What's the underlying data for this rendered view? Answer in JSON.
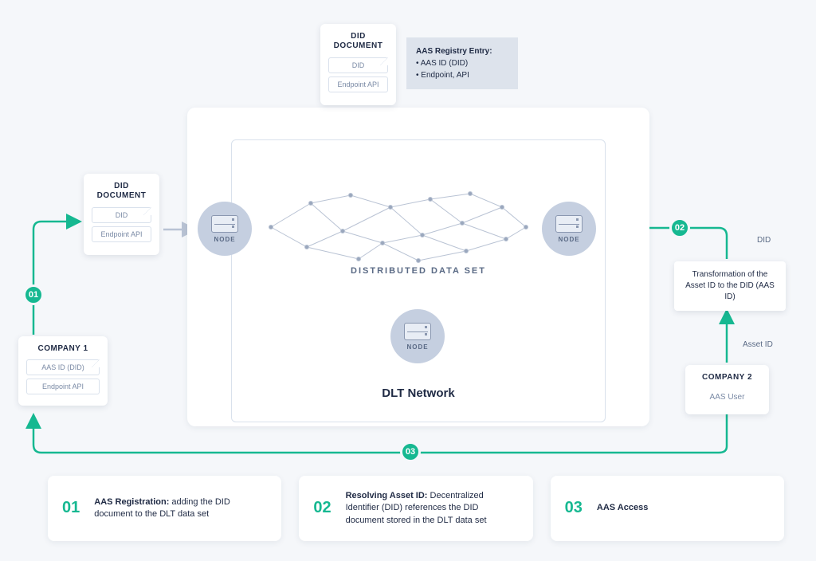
{
  "didDocument": {
    "title": "DID\nDOCUMENT",
    "chip1": "DID",
    "chip2": "Endpoint API"
  },
  "registry": {
    "heading": "AAS Registry Entry:",
    "line1": "• AAS ID (DID)",
    "line2": "• Endpoint, API"
  },
  "dlt": {
    "distributed": "DISTRIBUTED DATA SET",
    "title": "DLT Network",
    "nodeLabel": "NODE"
  },
  "company1": {
    "title": "COMPANY 1",
    "chip1": "AAS ID (DID)",
    "chip2": "Endpoint API"
  },
  "company2": {
    "title": "COMPANY 2",
    "sub": "AAS User"
  },
  "transform": {
    "text": "Transformation of the Asset ID to the DID (AAS ID)"
  },
  "labels": {
    "did": "DID",
    "assetId": "Asset ID"
  },
  "badges": {
    "s1": "01",
    "s2": "02",
    "s3": "03"
  },
  "legend": [
    {
      "num": "01",
      "bold": "AAS Registration:",
      "rest": " adding the DID document to the DLT data set"
    },
    {
      "num": "02",
      "bold": "Resolving Asset ID:",
      "rest": " Decentralized Identifier (DID) references the DID document stored in the DLT data set"
    },
    {
      "num": "03",
      "bold": "AAS Access",
      "rest": ""
    }
  ]
}
